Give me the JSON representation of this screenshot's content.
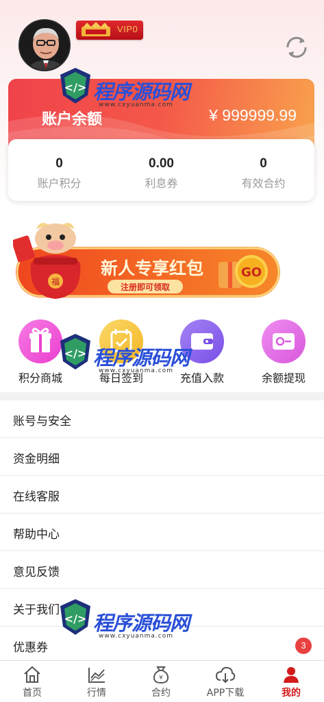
{
  "profile": {
    "vip_label": "VIP0",
    "avatar": "avatar-photo",
    "refresh_icon": "refresh-icon"
  },
  "balance": {
    "label": "账户余额",
    "value": "¥ 999999.99"
  },
  "stats": [
    {
      "value": "0",
      "label": "账户积分"
    },
    {
      "value": "0.00",
      "label": "利息券"
    },
    {
      "value": "0",
      "label": "有效合约"
    }
  ],
  "banner": {
    "title": "新人专享红包",
    "subtitle": "注册即可领取",
    "button": "GO",
    "fu": "福"
  },
  "quick_actions": [
    {
      "label": "积分商城",
      "icon": "gift-icon",
      "color": "#f25bd8"
    },
    {
      "label": "每日签到",
      "icon": "calendar-check-icon",
      "color": "#f7c53a"
    },
    {
      "label": "充值入款",
      "icon": "wallet-icon",
      "color": "#8a63ef"
    },
    {
      "label": "余额提现",
      "icon": "wallet-withdraw-icon",
      "color": "#e46be6"
    }
  ],
  "menu": [
    {
      "label": "账号与安全"
    },
    {
      "label": "资金明细"
    },
    {
      "label": "在线客服"
    },
    {
      "label": "帮助中心"
    },
    {
      "label": "意见反馈"
    },
    {
      "label": "关于我们"
    },
    {
      "label": "优惠券",
      "badge": "3"
    }
  ],
  "tabs": [
    {
      "label": "首页",
      "icon": "home-icon"
    },
    {
      "label": "行情",
      "icon": "chart-icon"
    },
    {
      "label": "合约",
      "icon": "money-bag-icon"
    },
    {
      "label": "APP下载",
      "icon": "cloud-download-icon"
    },
    {
      "label": "我的",
      "icon": "user-icon",
      "active": true
    }
  ],
  "watermark": {
    "text": "程序源码网",
    "url": "www.cxyuanma.com"
  },
  "colors": {
    "accent": "#d31b1b",
    "balance_gradient_start": "#f0424a",
    "balance_gradient_end": "#f9a24d",
    "badge": "#e8413f"
  }
}
